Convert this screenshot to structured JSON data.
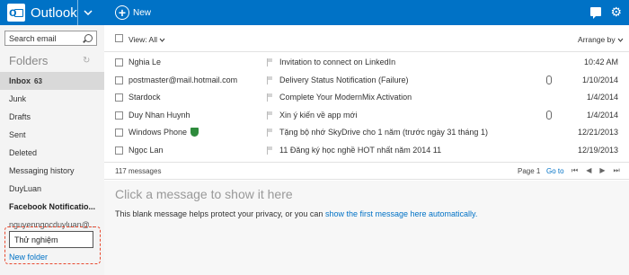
{
  "header": {
    "app_title": "Outlook",
    "new_label": "New"
  },
  "sidebar": {
    "search_placeholder": "Search email",
    "folders_title": "Folders",
    "folders": [
      {
        "name": "Inbox",
        "count": "63"
      },
      {
        "name": "Junk"
      },
      {
        "name": "Drafts"
      },
      {
        "name": "Sent"
      },
      {
        "name": "Deleted"
      },
      {
        "name": "Messaging history"
      },
      {
        "name": "DuyLuan"
      },
      {
        "name": "Facebook Notificatio..."
      },
      {
        "name": "nguyenngocduyluan@..."
      }
    ],
    "new_folder_value": "Thử nghiệm",
    "new_folder_link": "New folder"
  },
  "toolbar": {
    "view_label": "View: All",
    "arrange_label": "Arrange by"
  },
  "messages": [
    {
      "sender": "Nghia Le",
      "subject": "Invitation to connect on LinkedIn",
      "date": "10:42 AM",
      "attachment": false
    },
    {
      "sender": "postmaster@mail.hotmail.com",
      "subject": "Delivery Status Notification (Failure)",
      "date": "1/10/2014",
      "attachment": true
    },
    {
      "sender": "Stardock",
      "subject": "Complete Your ModernMix Activation",
      "date": "1/4/2014",
      "attachment": false
    },
    {
      "sender": "Duy Nhan Huynh",
      "subject": "Xin ý kiến về app mới",
      "date": "1/4/2014",
      "attachment": true
    },
    {
      "sender": "Windows Phone",
      "subject": "Tặng bộ nhớ SkyDrive cho 1 năm (trước ngày 31 tháng 1)",
      "date": "12/21/2013",
      "attachment": false
    },
    {
      "sender": "Ngọc Lan",
      "subject": "11 Đăng ký học nghề HOT nhất năm 2014 11",
      "date": "12/19/2013",
      "attachment": false
    }
  ],
  "list_footer": {
    "message_count": "117 messages",
    "page_label": "Page 1",
    "goto_label": "Go to"
  },
  "reading_pane": {
    "title": "Click a message to show it here",
    "note": "This blank message helps protect your privacy, or you can ",
    "link": "show the first message here automatically."
  }
}
